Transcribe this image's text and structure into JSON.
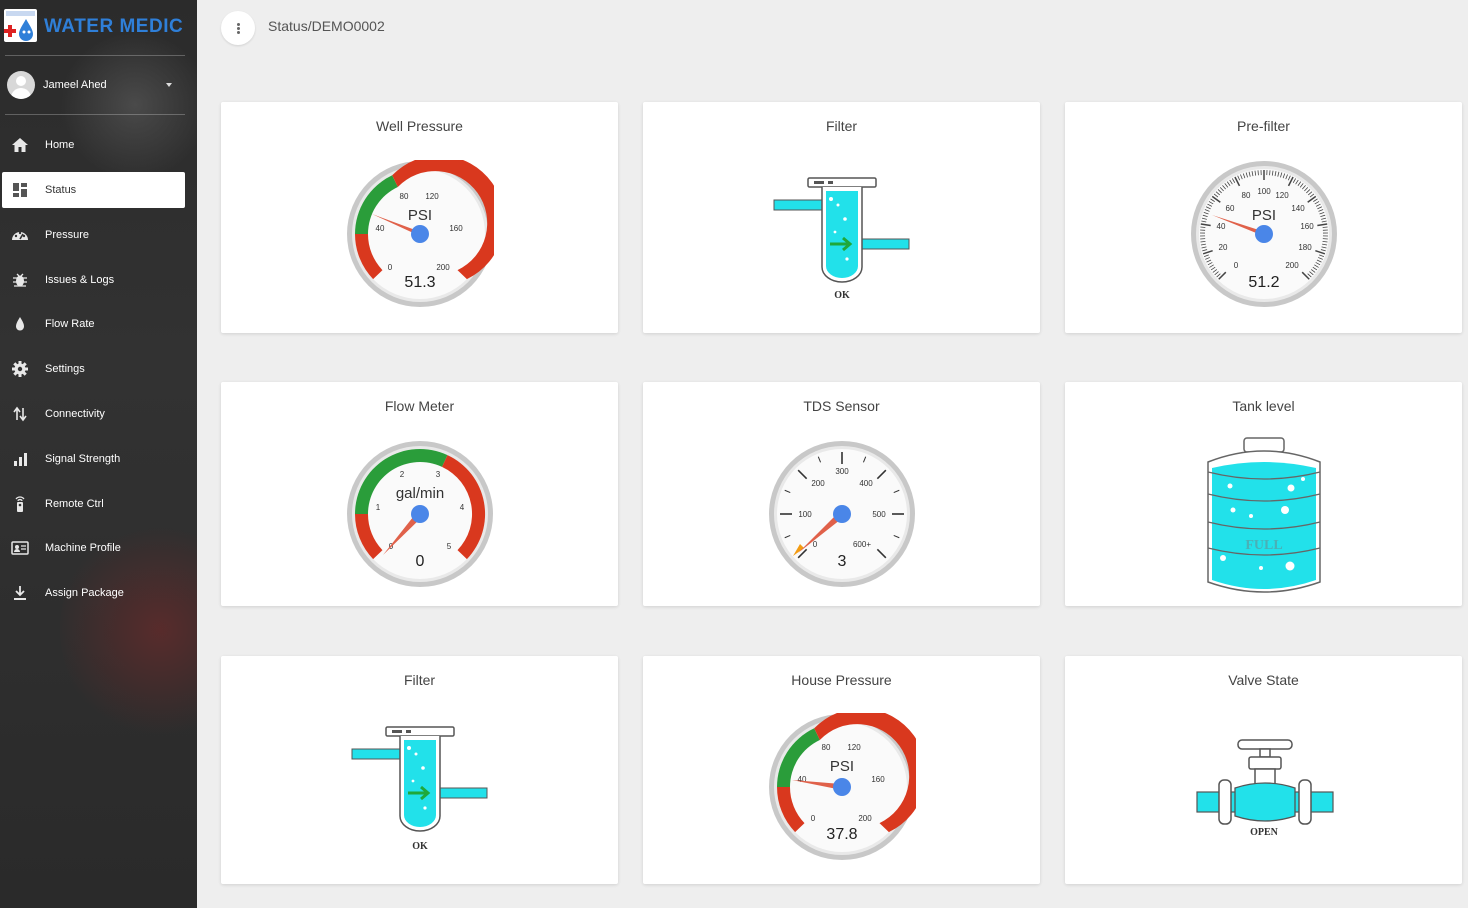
{
  "app": {
    "brand": "WATER MEDIC"
  },
  "user": {
    "name": "Jameel Ahed"
  },
  "sidebar": {
    "items": [
      {
        "label": "Home",
        "icon": "home-icon"
      },
      {
        "label": "Status",
        "icon": "dashboard-icon",
        "active": true
      },
      {
        "label": "Pressure",
        "icon": "speedometer-icon"
      },
      {
        "label": "Issues & Logs",
        "icon": "bug-icon"
      },
      {
        "label": "Flow Rate",
        "icon": "water-drop-icon"
      },
      {
        "label": "Settings",
        "icon": "gear-icon"
      },
      {
        "label": "Connectivity",
        "icon": "arrows-updown-icon"
      },
      {
        "label": "Signal Strength",
        "icon": "signal-bars-icon"
      },
      {
        "label": "Remote Ctrl",
        "icon": "remote-icon"
      },
      {
        "label": "Machine Profile",
        "icon": "id-card-icon"
      },
      {
        "label": "Assign Package",
        "icon": "download-icon"
      }
    ]
  },
  "header": {
    "breadcrumb": "Status/DEMO0002"
  },
  "cards": {
    "well_pressure": {
      "title": "Well Pressure",
      "unit": "PSI",
      "value": "51.3",
      "ticks": [
        "0",
        "40",
        "80",
        "120",
        "160",
        "200"
      ]
    },
    "filter1": {
      "title": "Filter",
      "status": "OK"
    },
    "prefilter": {
      "title": "Pre-filter",
      "unit": "PSI",
      "value": "51.2",
      "ticks": [
        "0",
        "20",
        "40",
        "60",
        "80",
        "100",
        "120",
        "140",
        "160",
        "180",
        "200"
      ]
    },
    "flow_meter": {
      "title": "Flow Meter",
      "unit": "gal/min",
      "value": "0",
      "ticks": [
        "0",
        "1",
        "2",
        "3",
        "4",
        "5"
      ]
    },
    "tds_sensor": {
      "title": "TDS Sensor",
      "value": "3",
      "ticks": [
        "0",
        "100",
        "200",
        "300",
        "400",
        "500",
        "600+"
      ]
    },
    "tank_level": {
      "title": "Tank level",
      "status": "FULL"
    },
    "filter2": {
      "title": "Filter",
      "status": "OK"
    },
    "house_pressure": {
      "title": "House Pressure",
      "unit": "PSI",
      "value": "37.8",
      "ticks": [
        "0",
        "40",
        "80",
        "120",
        "160",
        "200"
      ]
    },
    "valve_state": {
      "title": "Valve State",
      "status": "OPEN"
    }
  },
  "colors": {
    "accent_blue": "#2f7fd8",
    "gauge_green": "#2a9d3a",
    "gauge_red": "#d9381e",
    "needle": "#e0614a",
    "water": "#22e1ea",
    "pivot": "#4a86e8"
  }
}
